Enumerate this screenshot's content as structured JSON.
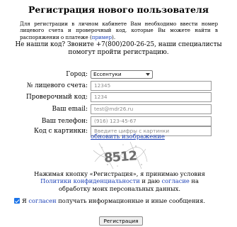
{
  "page_title": "Регистрация нового пользователя",
  "intro": {
    "text": "Для регистрации в личном кабинете Вам необходимо ввести номер лицевого счета и проверочный код, которые Вы можете найти в распоряжении о платеже (",
    "link": "пример",
    "tail": ")."
  },
  "help": {
    "line1": "Не нашли код? Звоните +7(800)200-26-25, наши специалисты",
    "line2": "помогут пройти регистрацию."
  },
  "form": {
    "city_label": "Город:",
    "city_value": "Ессентуки",
    "account_label": "№ лицевого счета:",
    "account_placeholder": "12345",
    "code_label": "Проверочный код:",
    "code_placeholder": "1234",
    "email_label": "Ваш email:",
    "email_placeholder": "test@mdr26.ru",
    "phone_label": "Ваш телефон:",
    "phone_placeholder": "(916) 123-45-67",
    "captcha_label": "Код с картинки:",
    "captcha_placeholder": "Введите цифры с картинки",
    "refresh_link": "обновить изображение",
    "captcha_text": "8512"
  },
  "agreement": {
    "text1": "Нажимая кнопку «Регистрация», я принимаю условия ",
    "policy_link": "Политики конфиденциальности",
    "text2": " и даю ",
    "consent_link": "согласие",
    "text3": " на обработку моих персональных данных."
  },
  "subscribe": {
    "text1": "Я ",
    "link": "согласен",
    "text2": " получать информационные и иные сообщения."
  },
  "submit_label": "Регистрация",
  "colors": {
    "link": "#1a3fb5",
    "checkbox": "#1a73e8"
  }
}
